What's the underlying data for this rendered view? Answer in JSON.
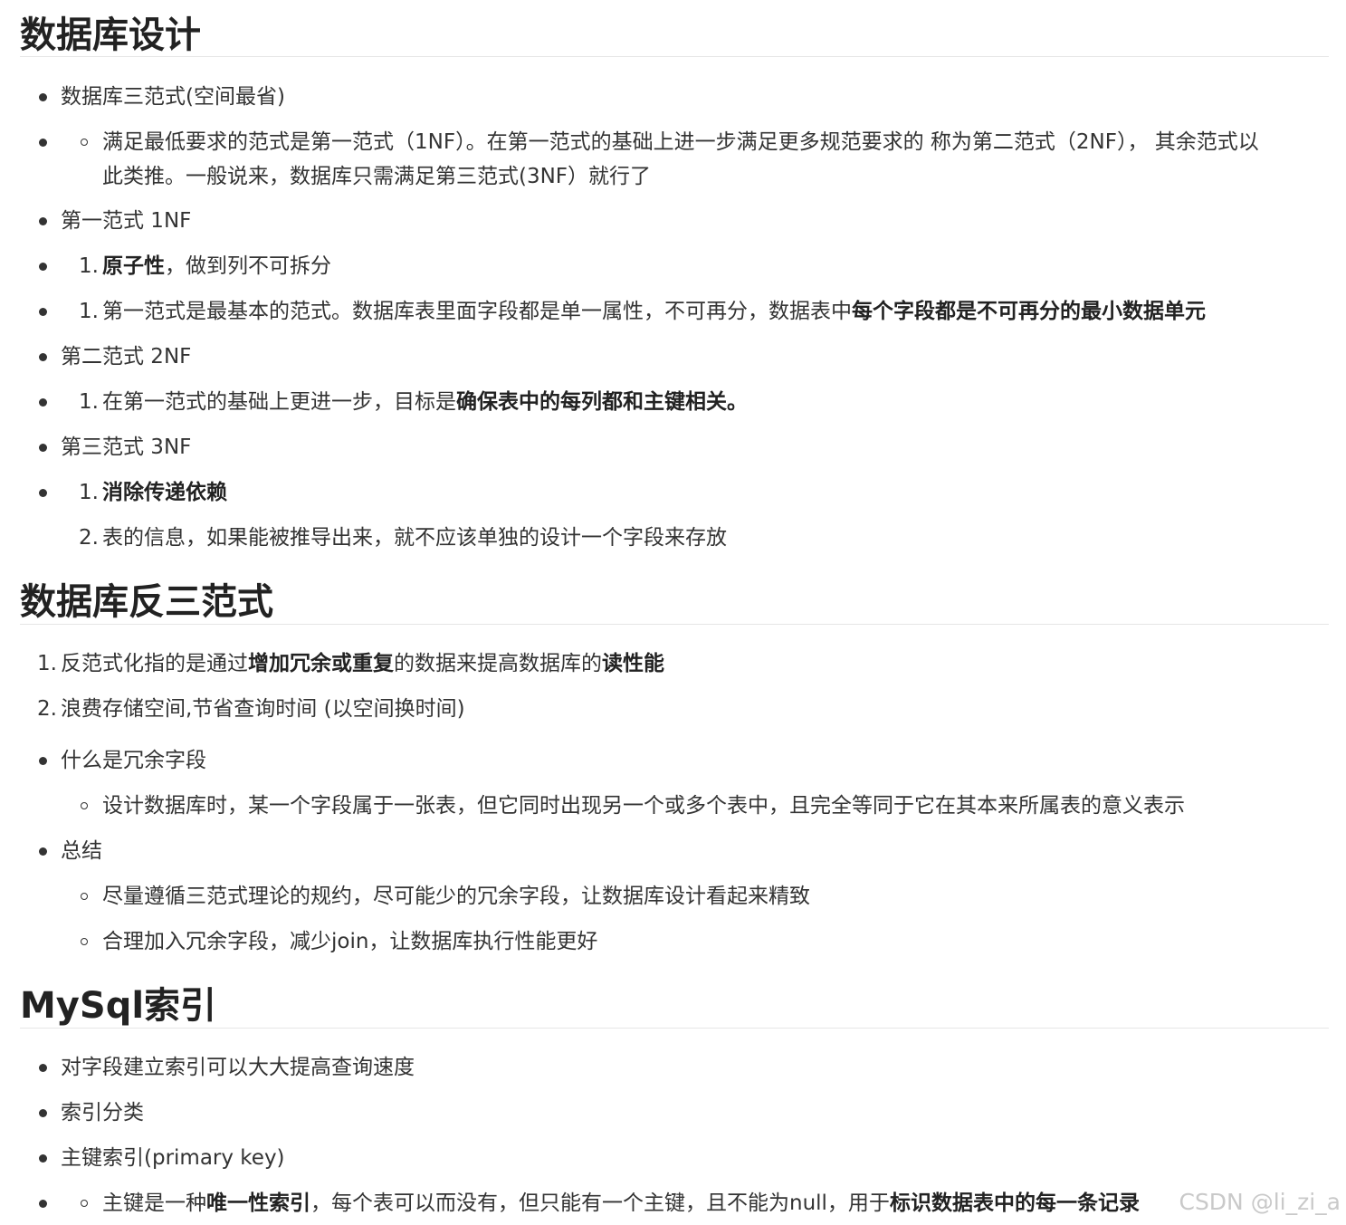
{
  "sections": {
    "design": {
      "title": "数据库设计",
      "items": {
        "nf_intro": "数据库三范式(空间最省)",
        "nf_desc_1": "满足最低要求的范式是第一范式（1NF）。在第一范式的基础上进一步满足更多规范要求的 称为第二范式（2NF）， 其余范式以",
        "nf_desc_2": "此类推。一般说来，数据库只需满足第三范式(3NF）就行了",
        "first": "第一范式 1NF",
        "first_1_bold": "原子性",
        "first_1_rest": "，做到列不可拆分",
        "first_2_plain": "第一范式是最基本的范式。数据库表里面字段都是单一属性，不可再分，数据表中",
        "first_2_bold": "每个字段都是不可再分的最小数据单元",
        "second": "第二范式 2NF",
        "second_1_plain": "在第一范式的基础上更进一步，目标是",
        "second_1_bold": "确保表中的每列都和主键相关。",
        "third": "第三范式 3NF",
        "third_1_bold": "消除传递依赖",
        "third_2": "表的信息，如果能被推导出来，就不应该单独的设计一个字段来存放"
      }
    },
    "denorm": {
      "title": "数据库反三范式",
      "items": {
        "d1_a": "反范式化指的是通过",
        "d1_b": "增加冗余或重复",
        "d1_c": "的数据来提高数据库的",
        "d1_d": "读性能",
        "d2": "浪费存储空间,节省查询时间 (以空间换时间)",
        "redundant": "什么是冗余字段",
        "redundant_desc": "设计数据库时，某一个字段属于一张表，但它同时出现另一个或多个表中，且完全等同于它在其本来所属表的意义表示",
        "summary": "总结",
        "summary_1": "尽量遵循三范式理论的规约，尽可能少的冗余字段，让数据库设计看起来精致",
        "summary_2": "合理加入冗余字段，减少join，让数据库执行性能更好"
      }
    },
    "index": {
      "title": "MySql索引",
      "items": {
        "i1": "对字段建立索引可以大大提高查询速度",
        "i2": "索引分类",
        "i3": "主键索引(primary key)",
        "i4_a": "主键是一种",
        "i4_b": "唯一性索引",
        "i4_c": "，每个表可以而没有，但只能有一个主键，且不能为null，用于",
        "i4_d": "标识数据表中的每一条记录"
      }
    }
  },
  "numbers": {
    "one": "1.",
    "two": "2."
  },
  "watermark": "CSDN @li_zi_a"
}
